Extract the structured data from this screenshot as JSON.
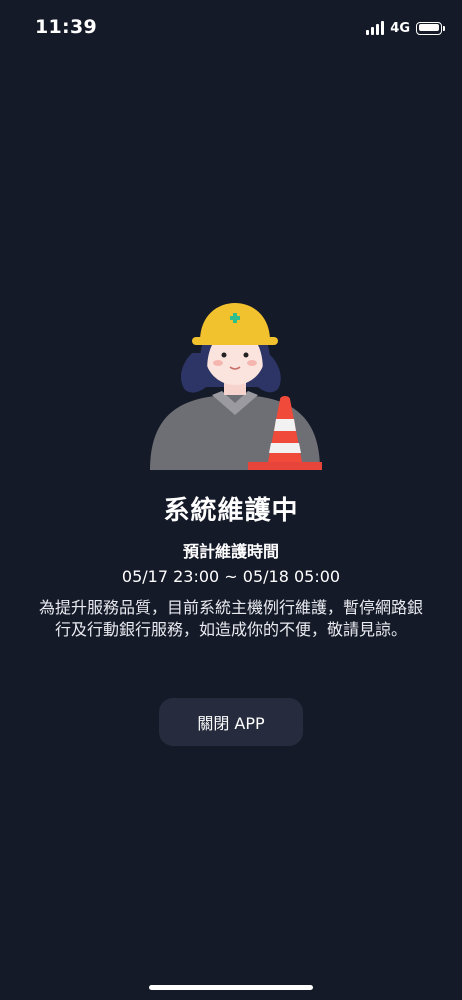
{
  "status_bar": {
    "time": "11:39",
    "network": "4G",
    "signal_icon": "signal-bars-icon",
    "battery_icon": "battery-icon"
  },
  "illustration": {
    "icon": "maintenance-worker-with-traffic-cone-illustration"
  },
  "maintenance": {
    "title": "系統維護中",
    "subtitle": "預計維護時間",
    "time_range": "05/17 23:00 ~ 05/18 05:00",
    "message": "為提升服務品質，目前系統主機例行維護，暫停網路銀行及行動銀行服務，如造成你的不便，敬請見諒。"
  },
  "actions": {
    "close_label": "關閉 APP"
  },
  "colors": {
    "background": "#151a28",
    "button_bg": "#262c3d",
    "helmet": "#f2c12e",
    "cone": "#f04a3a"
  }
}
